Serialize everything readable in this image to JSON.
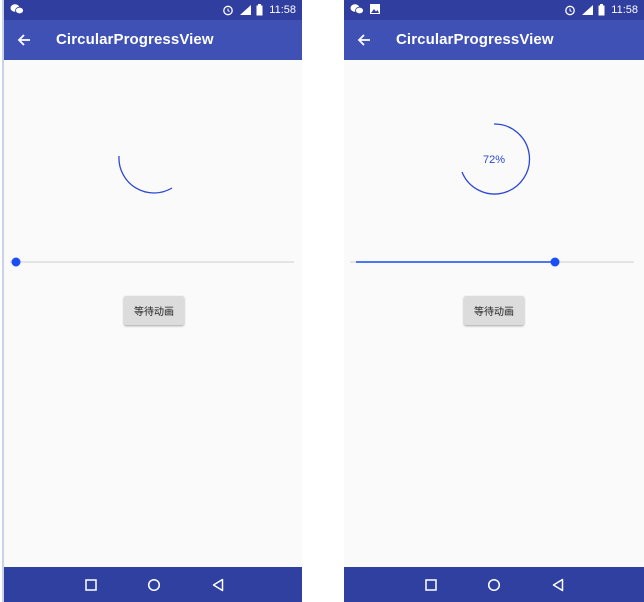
{
  "status_bar": {
    "time": "11:58"
  },
  "app_bar": {
    "title": "CircularProgressView"
  },
  "screens": [
    {
      "button_label": "等待动画",
      "progress_text": "",
      "seek_fraction": 0.0,
      "arc_fraction": 0.28
    },
    {
      "button_label": "等待动画",
      "progress_text": "72%",
      "seek_fraction": 0.72,
      "arc_fraction": 0.72
    }
  ],
  "colors": {
    "status_bar": "#303f9f",
    "app_bar": "#3f51b5",
    "accent": "#2b47d6",
    "nav_bar": "#3040a0",
    "background": "#fafafa"
  },
  "icons": [
    "wechat-icon",
    "image-icon",
    "alarm-icon",
    "signal-icon",
    "battery-icon",
    "back-arrow-icon",
    "square-recent-icon",
    "circle-home-icon",
    "triangle-back-icon"
  ]
}
